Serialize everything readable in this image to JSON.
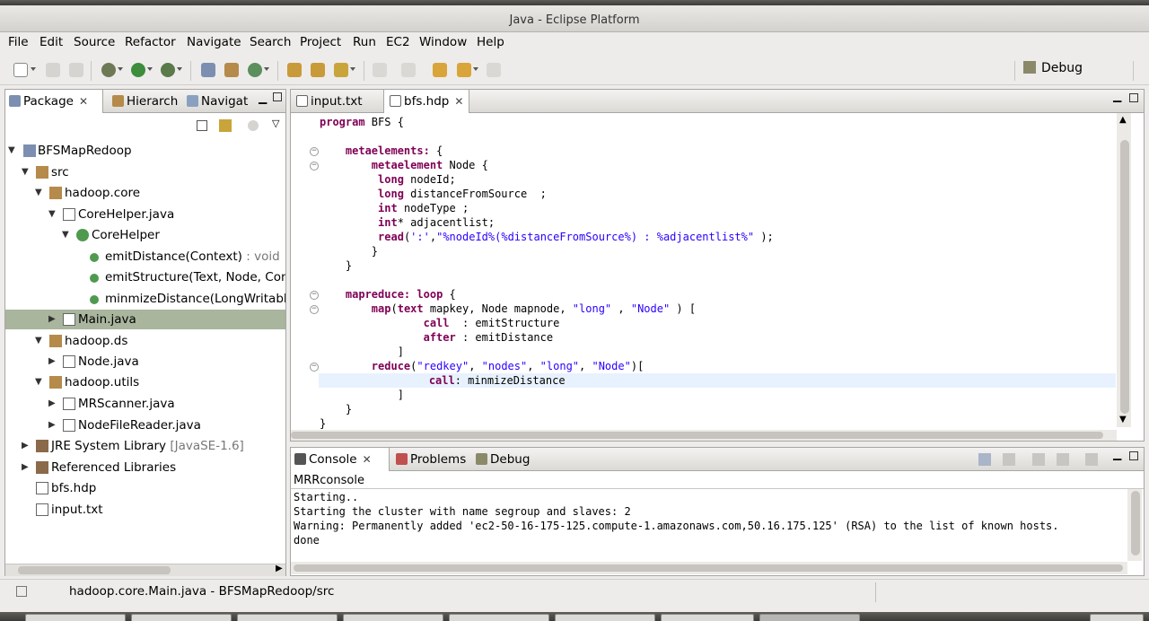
{
  "window": {
    "title": "Java - Eclipse Platform"
  },
  "menu": [
    "File",
    "Edit",
    "Source",
    "Refactor",
    "Navigate",
    "Search",
    "Project",
    "Run",
    "EC2",
    "Window",
    "Help"
  ],
  "perspective": {
    "label": "Debug"
  },
  "left_panel": {
    "tabs": [
      {
        "label": "Package"
      },
      {
        "label": "Hierarch"
      },
      {
        "label": "Navigat"
      }
    ],
    "tree": [
      {
        "label": "BFSMapRedoop",
        "extra": ""
      },
      {
        "label": "src",
        "extra": ""
      },
      {
        "label": "hadoop.core",
        "extra": ""
      },
      {
        "label": "CoreHelper.java",
        "extra": ""
      },
      {
        "label": "CoreHelper",
        "extra": ""
      },
      {
        "label": "emitDistance(Context)",
        "extra": " : void"
      },
      {
        "label": "emitStructure(Text, Node, Conte",
        "extra": ""
      },
      {
        "label": "minmizeDistance(LongWritable",
        "extra": ""
      },
      {
        "label": "Main.java",
        "extra": ""
      },
      {
        "label": "hadoop.ds",
        "extra": ""
      },
      {
        "label": "Node.java",
        "extra": ""
      },
      {
        "label": "hadoop.utils",
        "extra": ""
      },
      {
        "label": "MRScanner.java",
        "extra": ""
      },
      {
        "label": "NodeFileReader.java",
        "extra": ""
      },
      {
        "label": "JRE System Library",
        "extra": " [JavaSE-1.6]"
      },
      {
        "label": "Referenced Libraries",
        "extra": ""
      },
      {
        "label": "bfs.hdp",
        "extra": ""
      },
      {
        "label": "input.txt",
        "extra": ""
      }
    ]
  },
  "editor": {
    "tabs": [
      {
        "label": "input.txt"
      },
      {
        "label": "bfs.hdp"
      }
    ]
  },
  "console": {
    "tabs": [
      {
        "label": "Console"
      },
      {
        "label": "Problems"
      },
      {
        "label": "Debug"
      }
    ],
    "name": "MRRconsole",
    "lines": [
      "Starting..",
      "Starting the cluster with name segroup and slaves: 2",
      "Warning: Permanently added 'ec2-50-16-175-125.compute-1.amazonaws.com,50.16.175.125' (RSA) to the list of known hosts.",
      "done"
    ]
  },
  "status": {
    "text": "hadoop.core.Main.java - BFSMapRedoop/src"
  },
  "colors": {
    "keyword": "#7f0055",
    "string": "#2a00ff",
    "selection": "#a9b59d"
  }
}
